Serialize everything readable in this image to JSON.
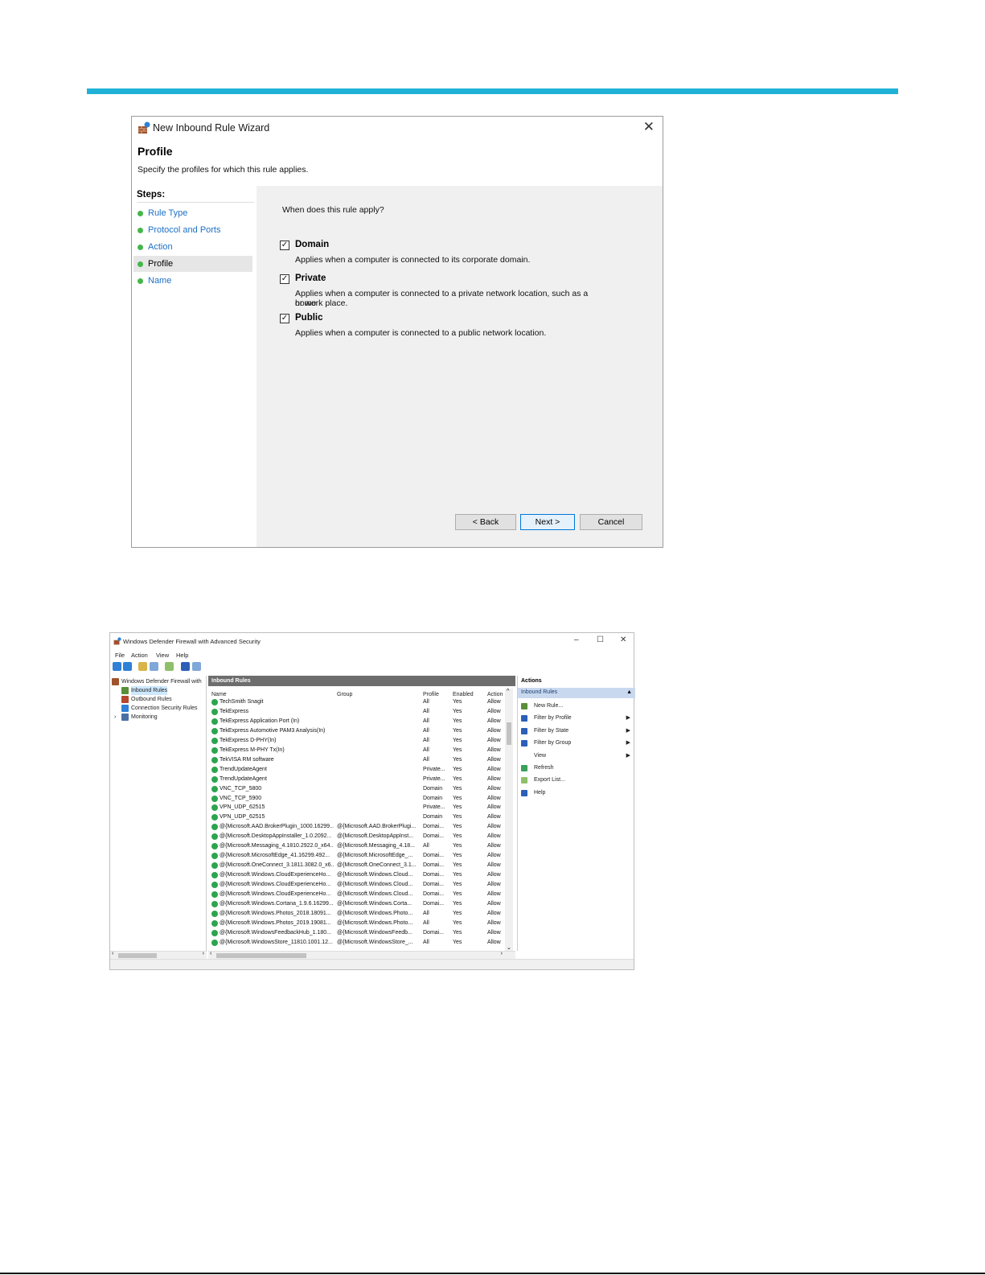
{
  "wizard": {
    "title": "New Inbound Rule Wizard",
    "close_glyph": "✕",
    "heading": "Profile",
    "subtitle": "Specify the profiles for which this rule applies.",
    "steps_label": "Steps:",
    "steps": [
      {
        "label": "Rule Type"
      },
      {
        "label": "Protocol and Ports"
      },
      {
        "label": "Action"
      },
      {
        "label": "Profile"
      },
      {
        "label": "Name"
      }
    ],
    "question": "When does this rule apply?",
    "options": [
      {
        "label": "Domain",
        "checked": true,
        "desc1": "Applies when a computer is connected to its corporate domain.",
        "desc2": ""
      },
      {
        "label": "Private",
        "checked": true,
        "desc1": "Applies when a computer is connected to a private network location, such as a home",
        "desc2": "or work place."
      },
      {
        "label": "Public",
        "checked": true,
        "desc1": "Applies when a computer is connected to a public network location.",
        "desc2": ""
      }
    ],
    "check_glyph": "✓",
    "buttons": {
      "back": "< Back",
      "next": "Next >",
      "cancel": "Cancel"
    }
  },
  "firewall": {
    "title": "Windows Defender Firewall with Advanced Security",
    "controls": {
      "minimize": "–",
      "maximize": "☐",
      "close": "✕"
    },
    "menu": [
      "File",
      "Action",
      "View",
      "Help"
    ],
    "tree": [
      {
        "label": "Windows Defender Firewall with",
        "icon": "firewall-icon"
      },
      {
        "label": "Inbound Rules",
        "icon": "inbound-rules-icon"
      },
      {
        "label": "Outbound Rules",
        "icon": "outbound-rules-icon"
      },
      {
        "label": "Connection Security Rules",
        "icon": "connection-security-icon"
      },
      {
        "label": "Monitoring",
        "icon": "monitoring-icon"
      }
    ],
    "tree_expand_glyph": "›",
    "scroll_left": "‹",
    "scroll_right": "›",
    "scroll_up": "^",
    "scroll_down": "⌄",
    "panel_title": "Inbound Rules",
    "columns": {
      "name": "Name",
      "group": "Group",
      "profile": "Profile",
      "enabled": "Enabled",
      "action": "Action"
    },
    "rules": [
      {
        "name": "TechSmith Snagit",
        "group": "",
        "profile": "All",
        "enabled": "Yes",
        "action": "Allow"
      },
      {
        "name": "TekExpress",
        "group": "",
        "profile": "All",
        "enabled": "Yes",
        "action": "Allow"
      },
      {
        "name": "TekExpress Application Port (In)",
        "group": "",
        "profile": "All",
        "enabled": "Yes",
        "action": "Allow"
      },
      {
        "name": "TekExpress Automotive PAM3 Analysis(In)",
        "group": "",
        "profile": "All",
        "enabled": "Yes",
        "action": "Allow"
      },
      {
        "name": "TekExpress D-PHY(In)",
        "group": "",
        "profile": "All",
        "enabled": "Yes",
        "action": "Allow"
      },
      {
        "name": "TekExpress M-PHY Tx(In)",
        "group": "",
        "profile": "All",
        "enabled": "Yes",
        "action": "Allow"
      },
      {
        "name": "TekVISA RM software",
        "group": "",
        "profile": "All",
        "enabled": "Yes",
        "action": "Allow"
      },
      {
        "name": "TrendUpdateAgent",
        "group": "",
        "profile": "Private...",
        "enabled": "Yes",
        "action": "Allow"
      },
      {
        "name": "TrendUpdateAgent",
        "group": "",
        "profile": "Private...",
        "enabled": "Yes",
        "action": "Allow"
      },
      {
        "name": "VNC_TCP_5800",
        "group": "",
        "profile": "Domain",
        "enabled": "Yes",
        "action": "Allow"
      },
      {
        "name": "VNC_TCP_5900",
        "group": "",
        "profile": "Domain",
        "enabled": "Yes",
        "action": "Allow"
      },
      {
        "name": "VPN_UDP_62515",
        "group": "",
        "profile": "Private...",
        "enabled": "Yes",
        "action": "Allow"
      },
      {
        "name": "VPN_UDP_62515",
        "group": "",
        "profile": "Domain",
        "enabled": "Yes",
        "action": "Allow"
      },
      {
        "name": "@{Microsoft.AAD.BrokerPlugin_1000.16299...",
        "group": "@{Microsoft.AAD.BrokerPlugi...",
        "profile": "Domai...",
        "enabled": "Yes",
        "action": "Allow"
      },
      {
        "name": "@{Microsoft.DesktopAppInstaller_1.0.2092...",
        "group": "@{Microsoft.DesktopAppInst...",
        "profile": "Domai...",
        "enabled": "Yes",
        "action": "Allow"
      },
      {
        "name": "@{Microsoft.Messaging_4.1810.2922.0_x64...",
        "group": "@{Microsoft.Messaging_4.18...",
        "profile": "All",
        "enabled": "Yes",
        "action": "Allow"
      },
      {
        "name": "@{Microsoft.MicrosoftEdge_41.16299.492...",
        "group": "@{Microsoft.MicrosoftEdge_...",
        "profile": "Domai...",
        "enabled": "Yes",
        "action": "Allow"
      },
      {
        "name": "@{Microsoft.OneConnect_3.1811.3082.0_x6...",
        "group": "@{Microsoft.OneConnect_3.1...",
        "profile": "Domai...",
        "enabled": "Yes",
        "action": "Allow"
      },
      {
        "name": "@{Microsoft.Windows.CloudExperienceHo...",
        "group": "@{Microsoft.Windows.Cloud...",
        "profile": "Domai...",
        "enabled": "Yes",
        "action": "Allow"
      },
      {
        "name": "@{Microsoft.Windows.CloudExperienceHo...",
        "group": "@{Microsoft.Windows.Cloud...",
        "profile": "Domai...",
        "enabled": "Yes",
        "action": "Allow"
      },
      {
        "name": "@{Microsoft.Windows.CloudExperienceHo...",
        "group": "@{Microsoft.Windows.Cloud...",
        "profile": "Domai...",
        "enabled": "Yes",
        "action": "Allow"
      },
      {
        "name": "@{Microsoft.Windows.Cortana_1.9.6.16299...",
        "group": "@{Microsoft.Windows.Corta...",
        "profile": "Domai...",
        "enabled": "Yes",
        "action": "Allow"
      },
      {
        "name": "@{Microsoft.Windows.Photos_2018.18091...",
        "group": "@{Microsoft.Windows.Photo...",
        "profile": "All",
        "enabled": "Yes",
        "action": "Allow"
      },
      {
        "name": "@{Microsoft.Windows.Photos_2019.19081...",
        "group": "@{Microsoft.Windows.Photo...",
        "profile": "All",
        "enabled": "Yes",
        "action": "Allow"
      },
      {
        "name": "@{Microsoft.WindowsFeedbackHub_1.180...",
        "group": "@{Microsoft.WindowsFeedb...",
        "profile": "Domai...",
        "enabled": "Yes",
        "action": "Allow"
      },
      {
        "name": "@{Microsoft.WindowsStore_11810.1001.12...",
        "group": "@{Microsoft.WindowsStore_...",
        "profile": "All",
        "enabled": "Yes",
        "action": "Allow"
      }
    ],
    "actions_title": "Actions",
    "actions_section": "Inbound Rules",
    "actions_section_glyph": "▲",
    "submenu_glyph": "▶",
    "actions": [
      {
        "label": "New Rule...",
        "icon": "new-rule-icon",
        "submenu": false
      },
      {
        "label": "Filter by Profile",
        "icon": "filter-icon",
        "submenu": true
      },
      {
        "label": "Filter by State",
        "icon": "filter-icon",
        "submenu": true
      },
      {
        "label": "Filter by Group",
        "icon": "filter-icon",
        "submenu": true
      },
      {
        "label": "View",
        "icon": "",
        "submenu": true
      },
      {
        "label": "Refresh",
        "icon": "refresh-icon",
        "submenu": false
      },
      {
        "label": "Export List...",
        "icon": "export-icon",
        "submenu": false
      },
      {
        "label": "Help",
        "icon": "help-icon",
        "submenu": false
      }
    ]
  }
}
